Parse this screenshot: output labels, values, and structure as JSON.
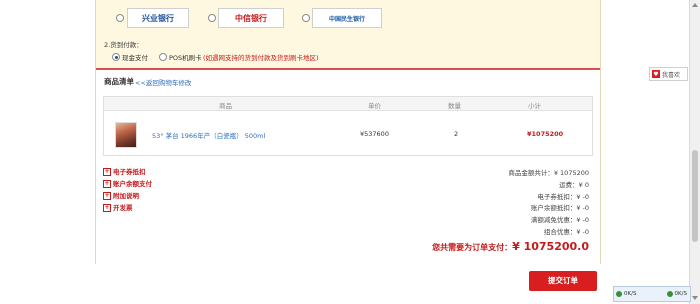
{
  "payment": {
    "banks": [
      {
        "name": "兴业银行",
        "color": "#1b4f9a"
      },
      {
        "name": "中信银行",
        "color": "#c41a1a"
      },
      {
        "name": "中国民生银行",
        "color": "#1c5aa8"
      }
    ],
    "delivery_pay_title": "2.货到付款：",
    "cash_label": "现金支付",
    "pos_label": "POS机刷卡",
    "pos_note": "(如遇网支持的货到付款及货到刷卡地区)"
  },
  "cart": {
    "title": "商品清单",
    "back_link": "<<返回购物车修改",
    "columns": [
      "商品",
      "单价",
      "数量",
      "小计"
    ],
    "items": [
      {
        "name": "53° 茅台 1966年产（白瓷瓶） 500ml",
        "price": "¥537600",
        "qty": "2",
        "subtotal": "¥1075200"
      }
    ]
  },
  "promos": [
    "电子券抵扣",
    "账户余额支付",
    "附加说明",
    "开发票"
  ],
  "summary": {
    "lines": [
      "商品金额共计：¥ 1075200",
      "运费：¥ 0",
      "电子券抵扣：¥ -0",
      "账户余额抵扣：¥ -0",
      "满额减免优惠：¥ -0",
      "组合优惠：¥ -0"
    ],
    "total_label": "您共需要为订单支付：",
    "total_value": "¥ 1075200.0"
  },
  "submit_label": "提交订单",
  "side_float_label": "我喜欢",
  "taskbar": {
    "left": "0K/S",
    "right": "0K/S"
  },
  "colors": {
    "accent": "#d81e1e",
    "link": "#2a6fbd",
    "pay_bg": "#fff8e1"
  }
}
